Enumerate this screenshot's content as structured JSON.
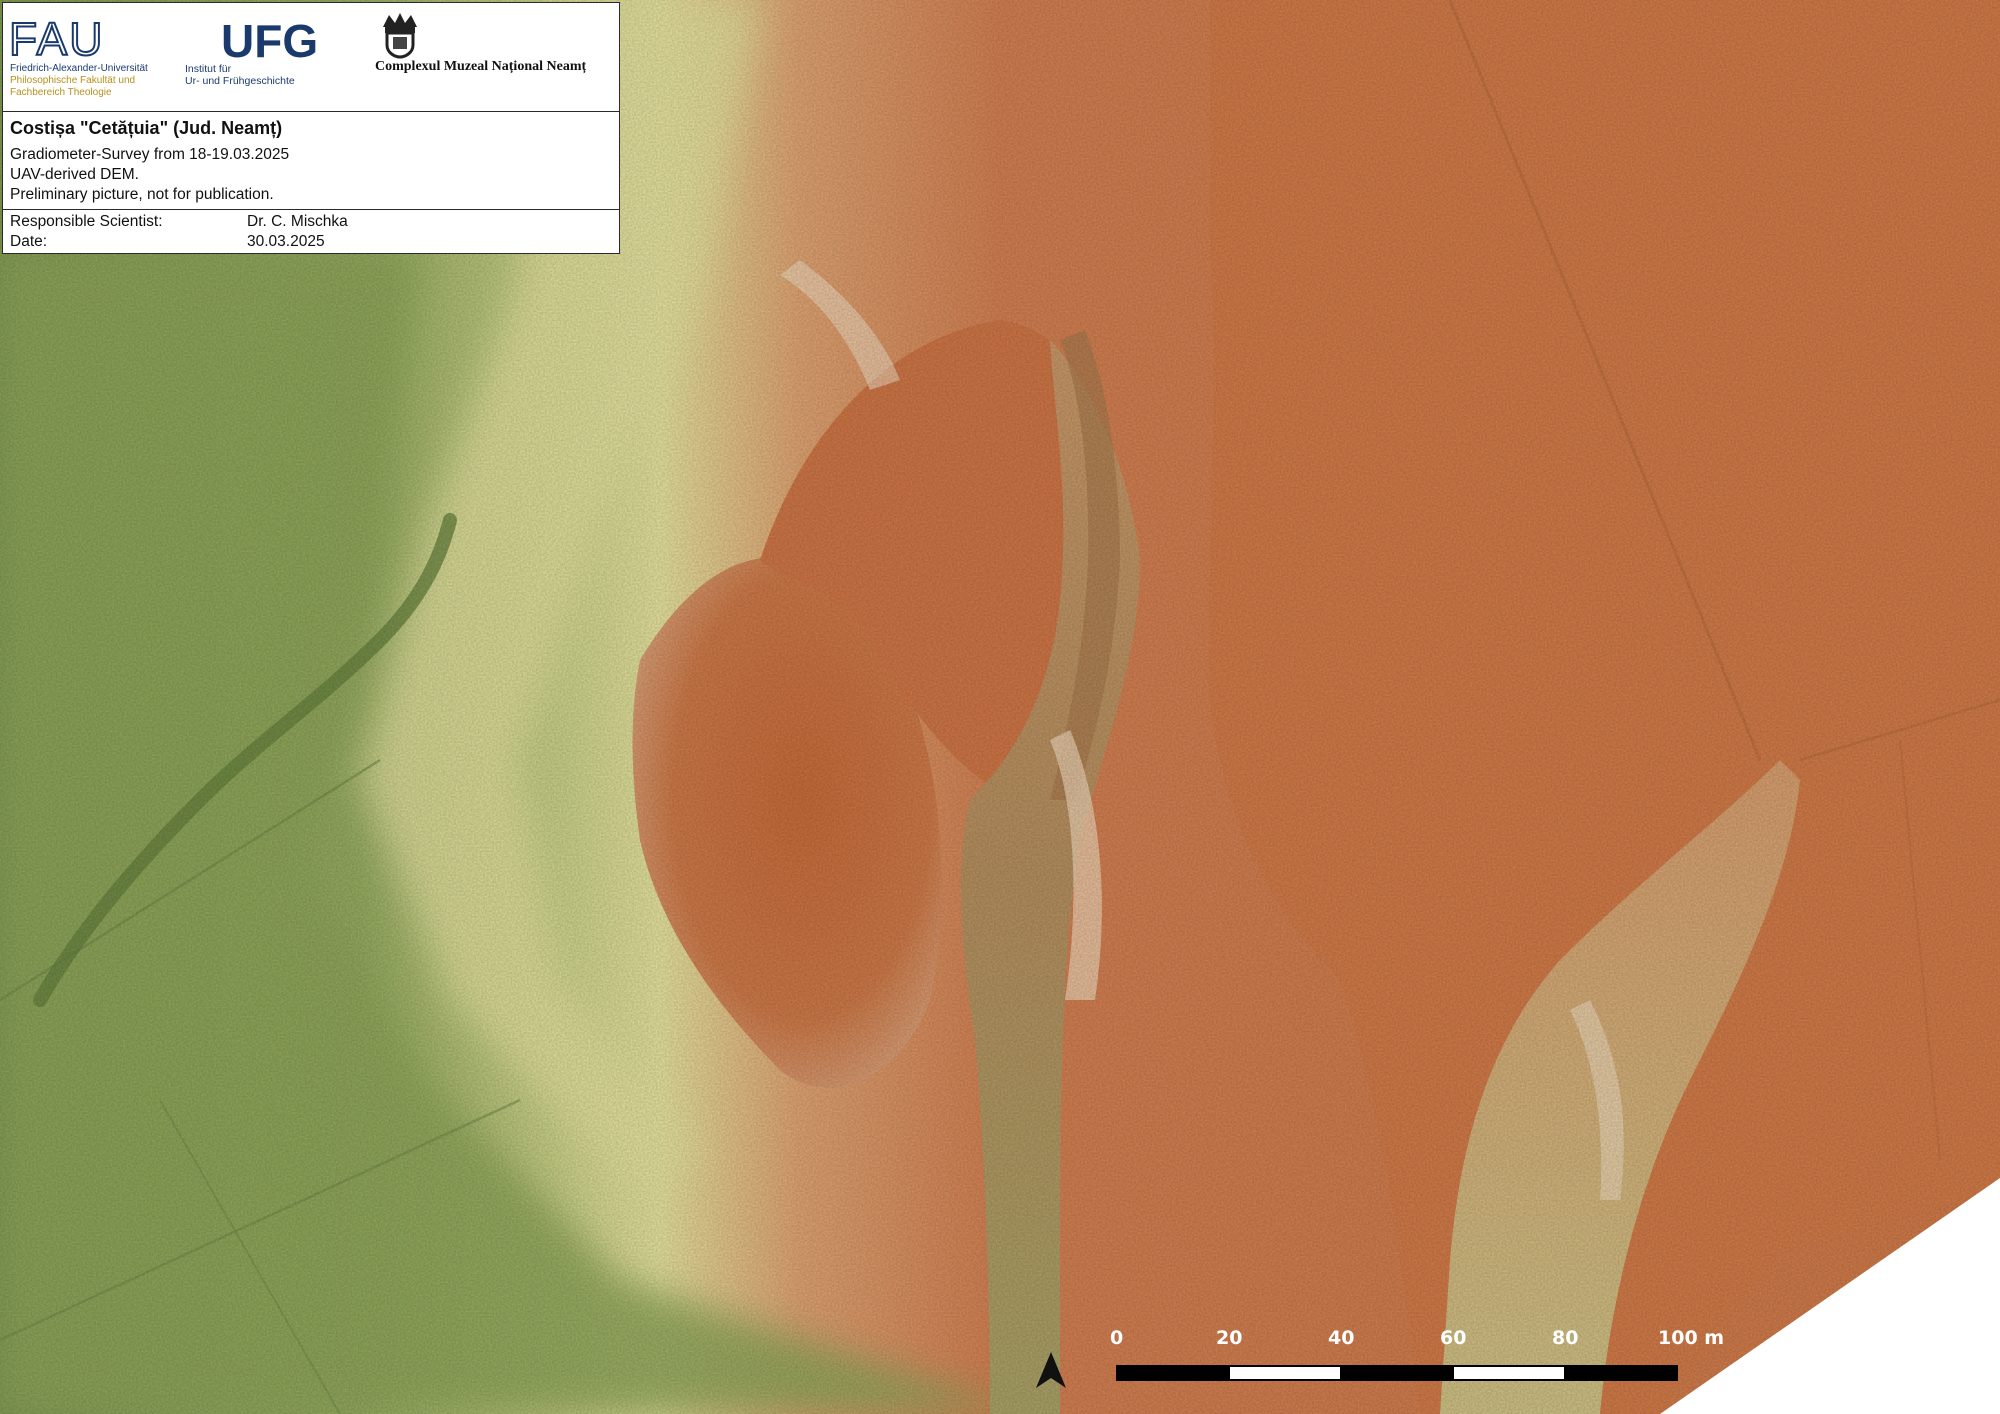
{
  "institutions": {
    "fau": {
      "logo_text": "FAU",
      "line1": "Friedrich-Alexander-Universität",
      "line2": "Philosophische Fakultät und",
      "line3": "Fachbereich Theologie"
    },
    "ufg": {
      "logo_text": "UFG",
      "line1": "Institut für",
      "line2": "Ur- und Frühgeschichte"
    },
    "museum": {
      "name": "Complexul Muzeal Național Neamț",
      "emblem_icon": "museum-emblem-icon"
    }
  },
  "site": {
    "title": "Costișa \"Cetățuia\" (Jud. Neamț)",
    "lines": [
      "Gradiometer-Survey from 18-19.03.2025",
      "UAV-derived DEM.",
      "Preliminary picture, not for publication."
    ]
  },
  "meta": {
    "scientist_label": "Responsible Scientist:",
    "scientist_value": "Dr. C. Mischka",
    "date_label": "Date:",
    "date_value": "30.03.2025"
  },
  "scale": {
    "ticks": [
      "0",
      "20",
      "40",
      "60",
      "80",
      "100 m"
    ],
    "units": "m"
  },
  "north_arrow": {
    "icon": "north-arrow-icon"
  },
  "colors": {
    "lowland_green": "#8aa35c",
    "mid_yellow": "#e3e09a",
    "highland_orange": "#d07a48",
    "hill_orange": "#c96e3e"
  }
}
